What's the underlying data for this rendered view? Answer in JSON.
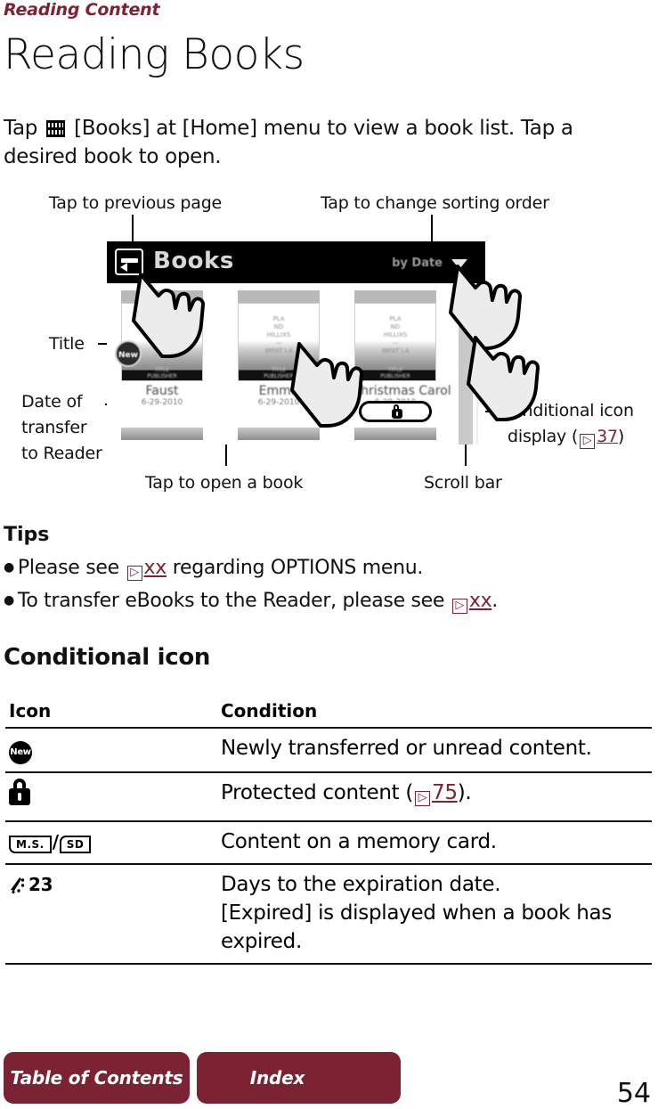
{
  "header": {
    "running_head": "Reading Content",
    "chapter_title": "Reading Books"
  },
  "intro": {
    "before_icon": "Tap ",
    "icon": "books-shelf-icon",
    "after_icon": " [Books] at [Home] menu to view a book list. Tap a desired book to open."
  },
  "diagram": {
    "callouts": {
      "prev_page": "Tap to previous page",
      "sorting_order": "Tap to change sorting order",
      "title": "Title",
      "date_of_transfer": "Date of\ntransfer\nto Reader",
      "open_book": "Tap to open a book",
      "scroll_bar": "Scroll bar",
      "conditional_icon_l1": "Conditional icon",
      "conditional_icon_l2_pre": "display (",
      "conditional_icon_ref": "37",
      "conditional_icon_l2_post": ")"
    },
    "device": {
      "bar_title": "Books",
      "sort_label": "by Date",
      "back_icon": "back-arrow-icon",
      "sort_caret_icon": "chevron-down-icon",
      "books": [
        {
          "title": "Faust",
          "date": "6-29-2010",
          "badge": "New",
          "cover_lines": "",
          "cover_foot": "TITLE\nPUBLISHER"
        },
        {
          "title": "Emma",
          "date": "6-29-2010",
          "badge": "",
          "cover_lines": "PLA\nND\nHILLIXS\n—\nIMFAT I.A",
          "cover_foot": "TITLE\nPUBLISHER"
        },
        {
          "title": "A Christmas Carol",
          "date": "6-29-2010",
          "badge": "",
          "cover_lines": "PLA\nND\nHILLIXS\n—\nIMFAT I.A",
          "cover_foot": "TITLE\nPUBLISHER"
        }
      ]
    }
  },
  "tips": {
    "heading": "Tips",
    "items": [
      {
        "pre": "Please see",
        "ref": "xx",
        "post": "regarding OPTIONS menu."
      },
      {
        "pre": "To transfer eBooks to the Reader, please see",
        "ref": "xx",
        "post": "."
      }
    ]
  },
  "conditional_icon": {
    "heading": "Conditional icon",
    "columns": [
      "Icon",
      "Condition"
    ],
    "rows": [
      {
        "icon_name": "new-badge-icon",
        "icon_text": "New",
        "condition": "Newly transferred or unread content."
      },
      {
        "icon_name": "lock-icon",
        "icon_text": "",
        "condition_pre": "Protected content (",
        "condition_ref": "75",
        "condition_post": ")."
      },
      {
        "icon_name": "memory-card-icon",
        "icon_text_ms": "M.S.",
        "icon_text_sep": "/",
        "icon_text_sd": "SD",
        "condition": "Content on a memory card."
      },
      {
        "icon_name": "expiration-clock-icon",
        "icon_text": "23",
        "condition": "Days to the expiration date.\n[Expired] is displayed when a book has expired."
      }
    ]
  },
  "footer": {
    "toc_label": "Table of Contents",
    "index_label": "Index",
    "page_number": "54"
  },
  "colors": {
    "accent": "#7b2333",
    "text": "#111111",
    "device_bar": "#000000"
  }
}
